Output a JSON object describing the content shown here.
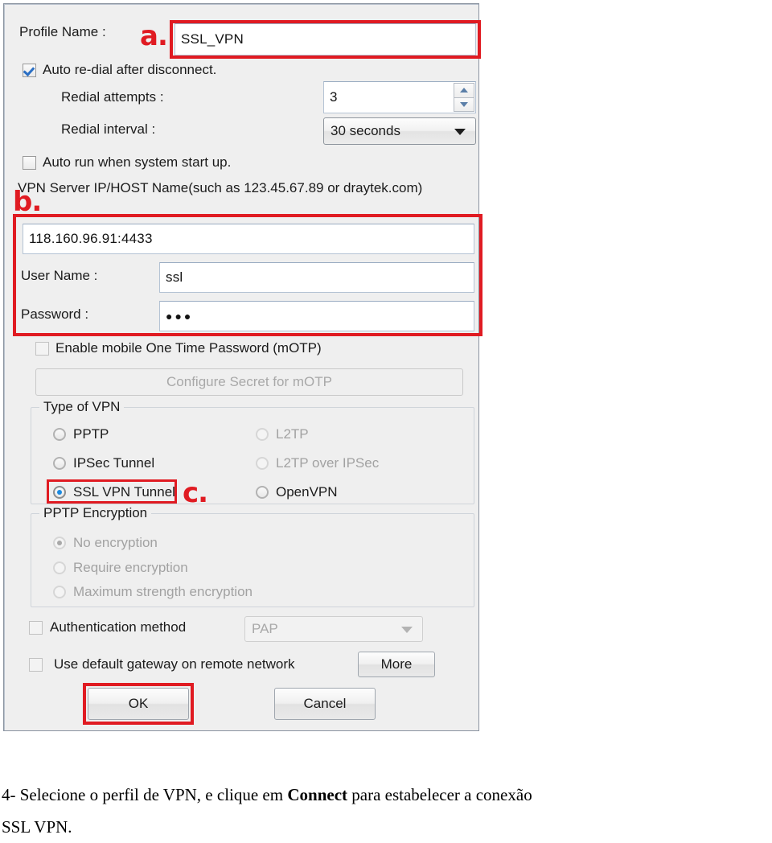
{
  "dialog": {
    "profile": {
      "label": "Profile Name :",
      "value": "SSL_VPN",
      "marker": "a."
    },
    "auto_redial": {
      "label": "Auto re-dial after disconnect.",
      "checked": true
    },
    "redial_attempts": {
      "label": "Redial attempts :",
      "value": "3"
    },
    "redial_interval": {
      "label": "Redial interval :",
      "value": "30 seconds"
    },
    "auto_run": {
      "label": "Auto run when system start up.",
      "checked": false
    },
    "server": {
      "hint": "VPN Server IP/HOST Name(such as 123.45.67.89 or draytek.com)",
      "value": "118.160.96.91:4433",
      "marker": "b."
    },
    "username": {
      "label": "User Name :",
      "value": "ssl"
    },
    "password": {
      "label": "Password :",
      "value": "●●●"
    },
    "motp": {
      "label": "Enable mobile One Time Password (mOTP)",
      "checked": false,
      "configure_button": "Configure Secret for mOTP"
    },
    "type_of_vpn": {
      "title": "Type of VPN",
      "marker": "c.",
      "options": [
        {
          "label": "PPTP",
          "selected": false,
          "disabled": false
        },
        {
          "label": "L2TP",
          "selected": false,
          "disabled": true
        },
        {
          "label": "IPSec Tunnel",
          "selected": false,
          "disabled": false
        },
        {
          "label": "L2TP over IPSec",
          "selected": false,
          "disabled": true
        },
        {
          "label": "SSL VPN Tunnel",
          "selected": true,
          "disabled": false
        },
        {
          "label": "OpenVPN",
          "selected": false,
          "disabled": false
        }
      ]
    },
    "pptp_encryption": {
      "title": "PPTP Encryption",
      "disabled": true,
      "options": [
        {
          "label": "No encryption",
          "selected": true
        },
        {
          "label": "Require encryption",
          "selected": false
        },
        {
          "label": "Maximum strength encryption",
          "selected": false
        }
      ]
    },
    "auth_method": {
      "label": "Authentication method",
      "checked": false,
      "value": "PAP"
    },
    "default_gateway": {
      "label": "Use default gateway on remote network",
      "checked": false,
      "more_button": "More"
    },
    "ok_button": "OK",
    "cancel_button": "Cancel"
  },
  "caption": {
    "line1_before": "4- Selecione o perfil de VPN, e clique em ",
    "line1_bold": "Connect",
    "line1_after": " para estabelecer a conexão",
    "line2": "SSL VPN."
  },
  "colors": {
    "highlight": "#e01b22",
    "accent_blue": "#1b8ae0",
    "dialog_bg": "#efefef"
  }
}
